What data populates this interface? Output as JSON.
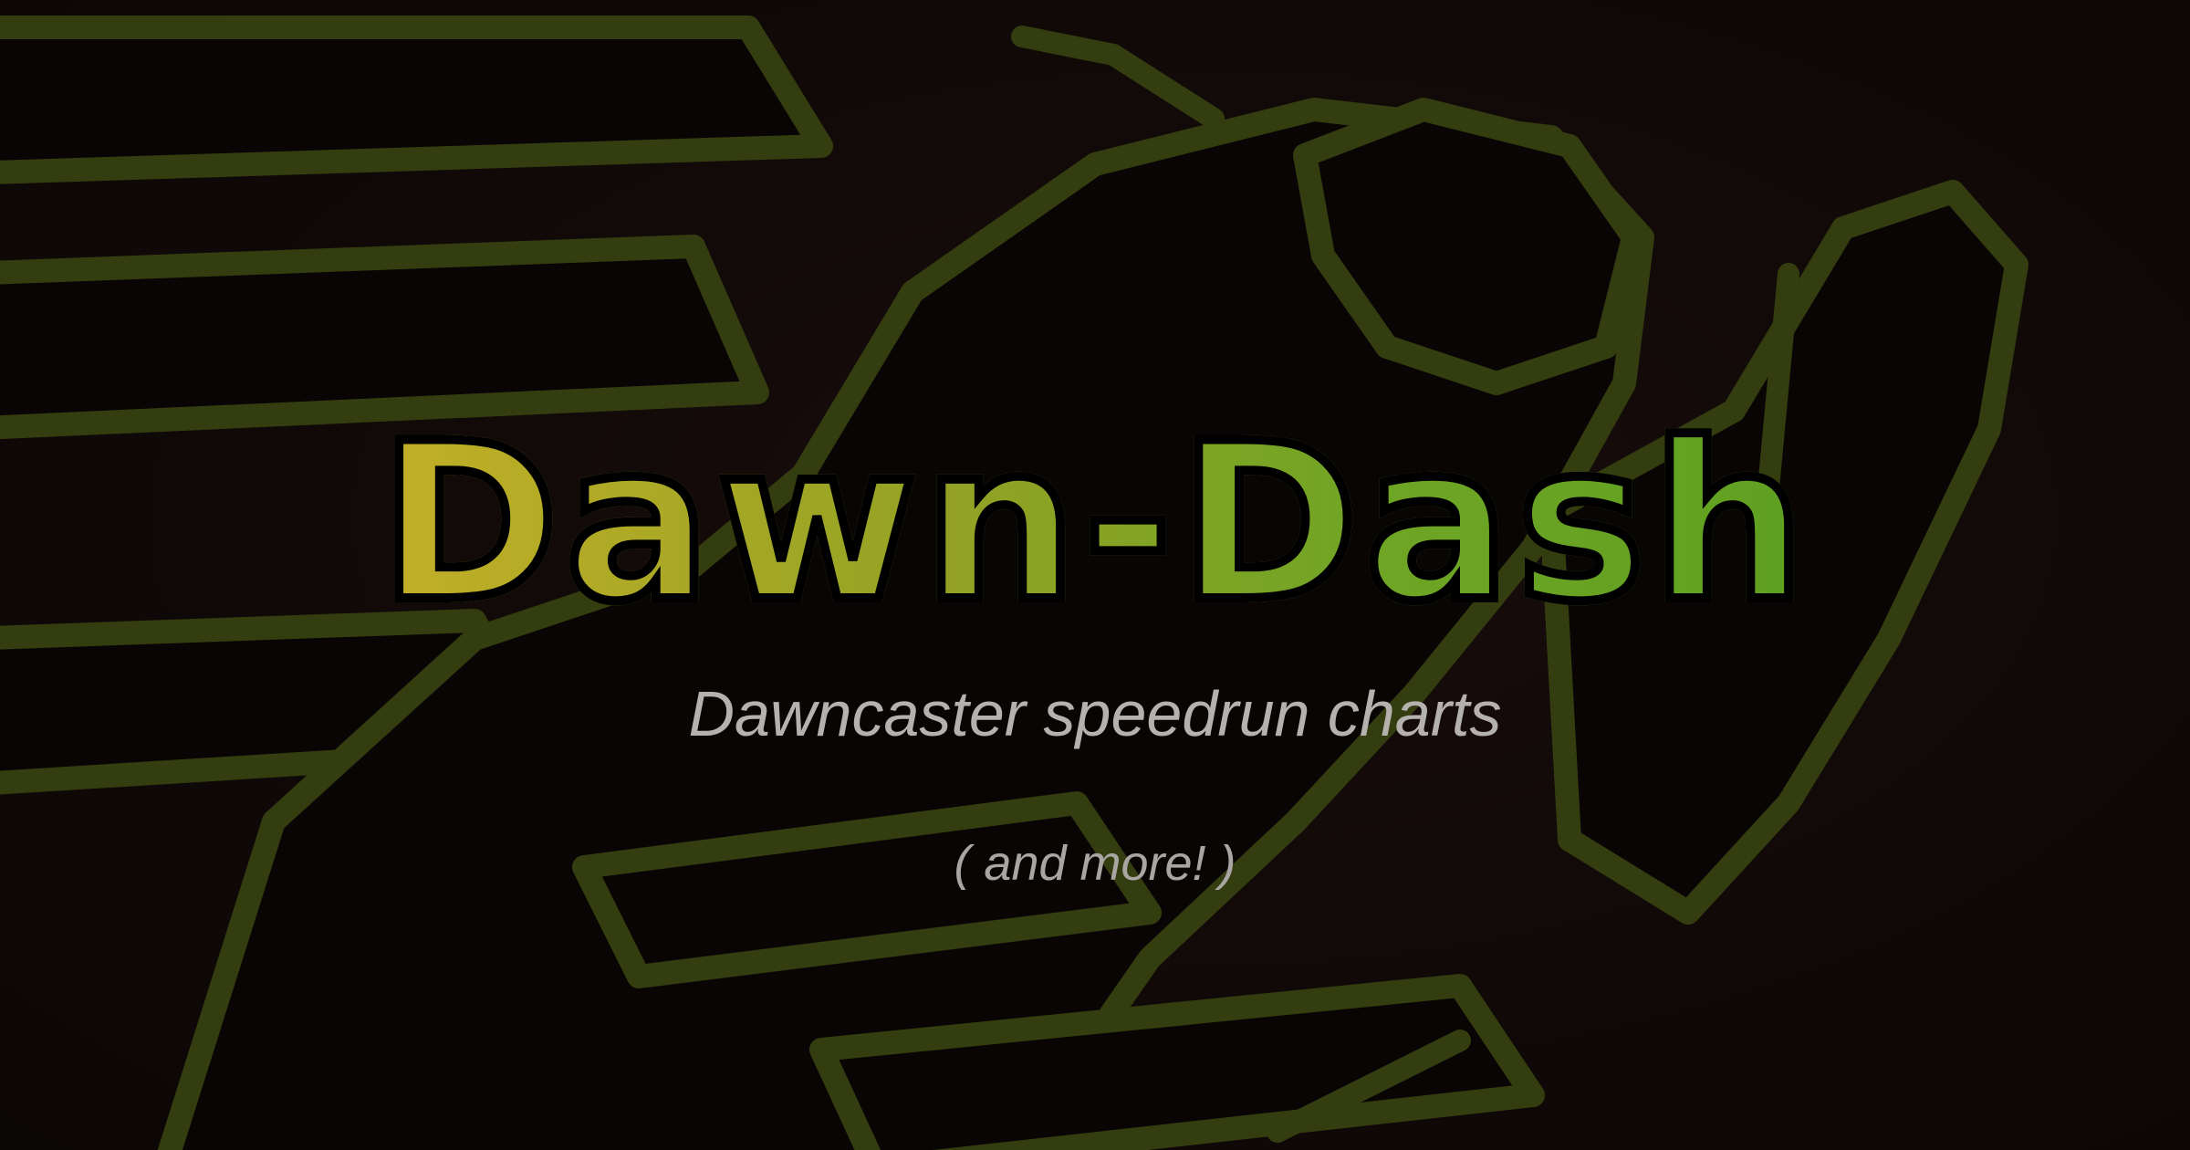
{
  "hero": {
    "title": "Dawn-Dash",
    "subtitle": "Dawncaster speedrun charts",
    "note": "( and more! )"
  },
  "background": {
    "icon": "runner-silhouette-icon",
    "outline_color": "#3d4a12",
    "figure_color": "#0a0606",
    "backdrop_color": "#1a0f0d"
  },
  "colors": {
    "title_gradient_start": "#c2af27",
    "title_gradient_end": "#5fa020",
    "title_outline": "#000000",
    "subtitle": "#b5b1af"
  }
}
